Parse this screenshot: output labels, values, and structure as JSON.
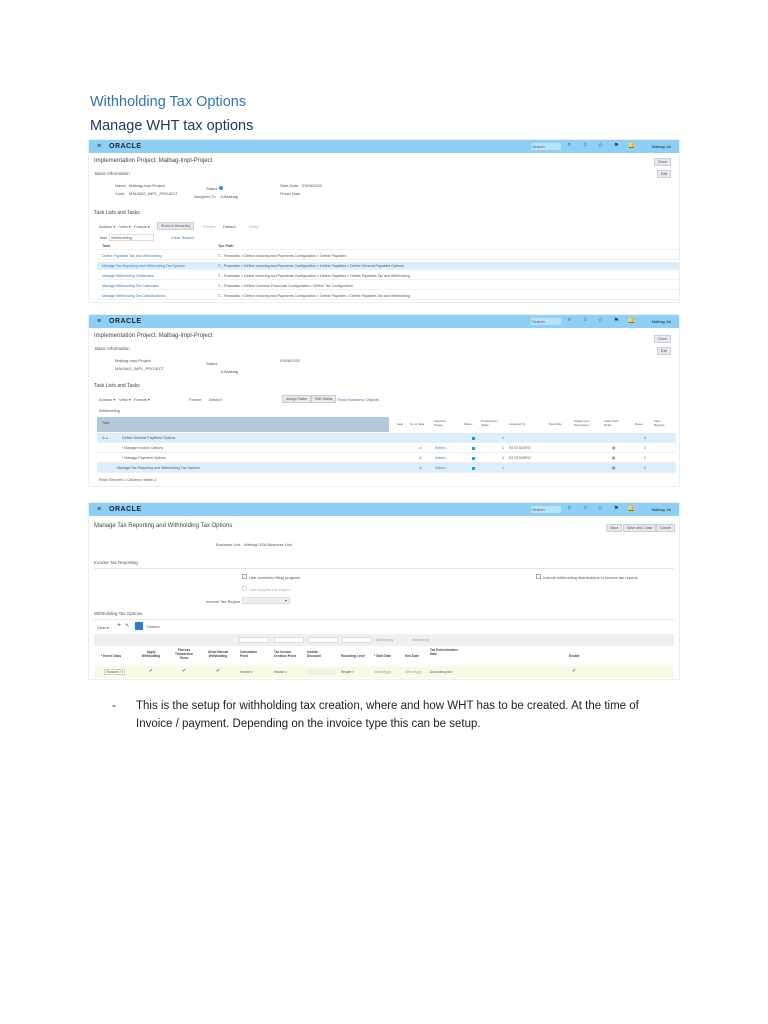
{
  "doc": {
    "title": "Withholding Tax Options",
    "subtitle": "Manage WHT tax options",
    "bullet": "This is the setup for withholding tax creation, where and how WHT has to be created. At the time of Invoice / payment. Depending on the invoice type this can be setup.",
    "dash": "-"
  },
  "app": {
    "logo": "ORACLE",
    "search": "Search",
    "user": "Malbag Jul",
    "badge": "9+"
  },
  "s1": {
    "project": "Implementation Project: Malbag-Impl-Project",
    "done": "Done",
    "edit": "Edit",
    "basic": "Basic Information",
    "name_l": "Name",
    "name_v": "Malbag-Impl-Project",
    "code_l": "Code",
    "code_v": "MALBAG_IMPL_PROJECT",
    "status_l": "Status",
    "assigned_l": "Assigned To",
    "assigned_v": "JUMalbag",
    "start_l": "Start Date",
    "start_v": "03/06/2020",
    "finish_l": "Finish Date",
    "tasks_title": "Task Lists and Tasks",
    "actions": "Actions ▾",
    "view": "View ▾",
    "format": "Format ▾",
    "show_hier": "Show in Hierarchy",
    "freeze": "Freeze",
    "detach": "Detach",
    "wrap": "Wrap",
    "task_l": "Task",
    "task_v": "Withholding",
    "clear": "Clear Search",
    "col_task": "Task",
    "col_path": "Tys Path",
    "rows": [
      {
        "task": "Define Payables Tax and Withholding",
        "path": "T... Financials > Define Invoicing and Payments Configuration > Define Payables"
      },
      {
        "task": "Manage Tax Reporting and Withholding Tax Options",
        "path": "T... Financials > Define Invoicing and Payments Configuration > Define Payables > Define General Payables Options"
      },
      {
        "task": "Manage Withholding Certificates",
        "path": "T... Financials > Define Invoicing and Payments Configuration > Define Payables > Define Payables Tax and Withholding"
      },
      {
        "task": "Manage Withholding Tax Calendars",
        "path": "T... Financials > Define Common Financials Configuration > Define Tax Configuration"
      },
      {
        "task": "Manage Withholding Tax Classifications",
        "path": "T... Financials > Define Invoicing and Payments Configuration > Define Payables > Define Payables Tax and Withholding"
      }
    ]
  },
  "s2": {
    "assign": "Assign Tasks",
    "edit_status": "Edit Status",
    "show_bo": "Show Business Objects",
    "cols": [
      "Help",
      "Go to Task",
      "Selected Scope",
      "Status",
      "Predecessor Tasks",
      "Assigned To",
      "Due Date",
      "Assignment Permission",
      "Authorized Roles",
      "Notes",
      "View Reports"
    ],
    "rows": [
      {
        "task": "Define General Payables Options",
        "scope": "",
        "pred": "1",
        "assigned": "",
        "notes": "0"
      },
      {
        "task": "* Manage Invoice Options",
        "scope": "Select...",
        "pred": "1",
        "assigned": "FA STUDENT",
        "notes": "0"
      },
      {
        "task": "* Manage Payment Options",
        "scope": "Select...",
        "pred": "1",
        "assigned": "FA STUDENT",
        "notes": "0"
      },
      {
        "task": "Manage Tax Reporting and Withholding Tax Options",
        "scope": "Select...",
        "pred": "1",
        "assigned": "",
        "notes": "0"
      }
    ],
    "footer": "Rows Selected  1     Columns Hidden  2"
  },
  "s3": {
    "title": "Manage Tax Reporting and Withholding Tax Options",
    "save": "Save",
    "save_close": "Save and Close",
    "cancel": "Cancel",
    "bu_l": "Business Unit",
    "bu_v": "Malbag USA Business Unit",
    "itr": "Income Tax Reporting",
    "combined": "Use combined filing program",
    "supplier_region": "Use supplier tax region",
    "include": "Include withholding distributions in income tax reports",
    "region_l": "Income Tax Region",
    "wto": "Withholding Tax Options",
    "view": "View ▾",
    "detach": "Detach",
    "date_ph": "dd/mm/yy",
    "cols": [
      "* Event Class",
      "Apply Withholding",
      "Process Transaction Taxes",
      "Allow Manual Withholding",
      "Calculation Point",
      "Tax Invoice Creation Point",
      "Include Discount",
      "Rounding Level",
      "* Start Date",
      "End Date",
      "Tax Determination Date",
      "Enable"
    ],
    "row": {
      "event": "Standard I",
      "calc": "Invoice",
      "creation": "Invoice",
      "rounding": "Header",
      "start": "dd/mm/yyyy",
      "end": "dd/mm/yyyy",
      "det": "Accounting da"
    }
  }
}
